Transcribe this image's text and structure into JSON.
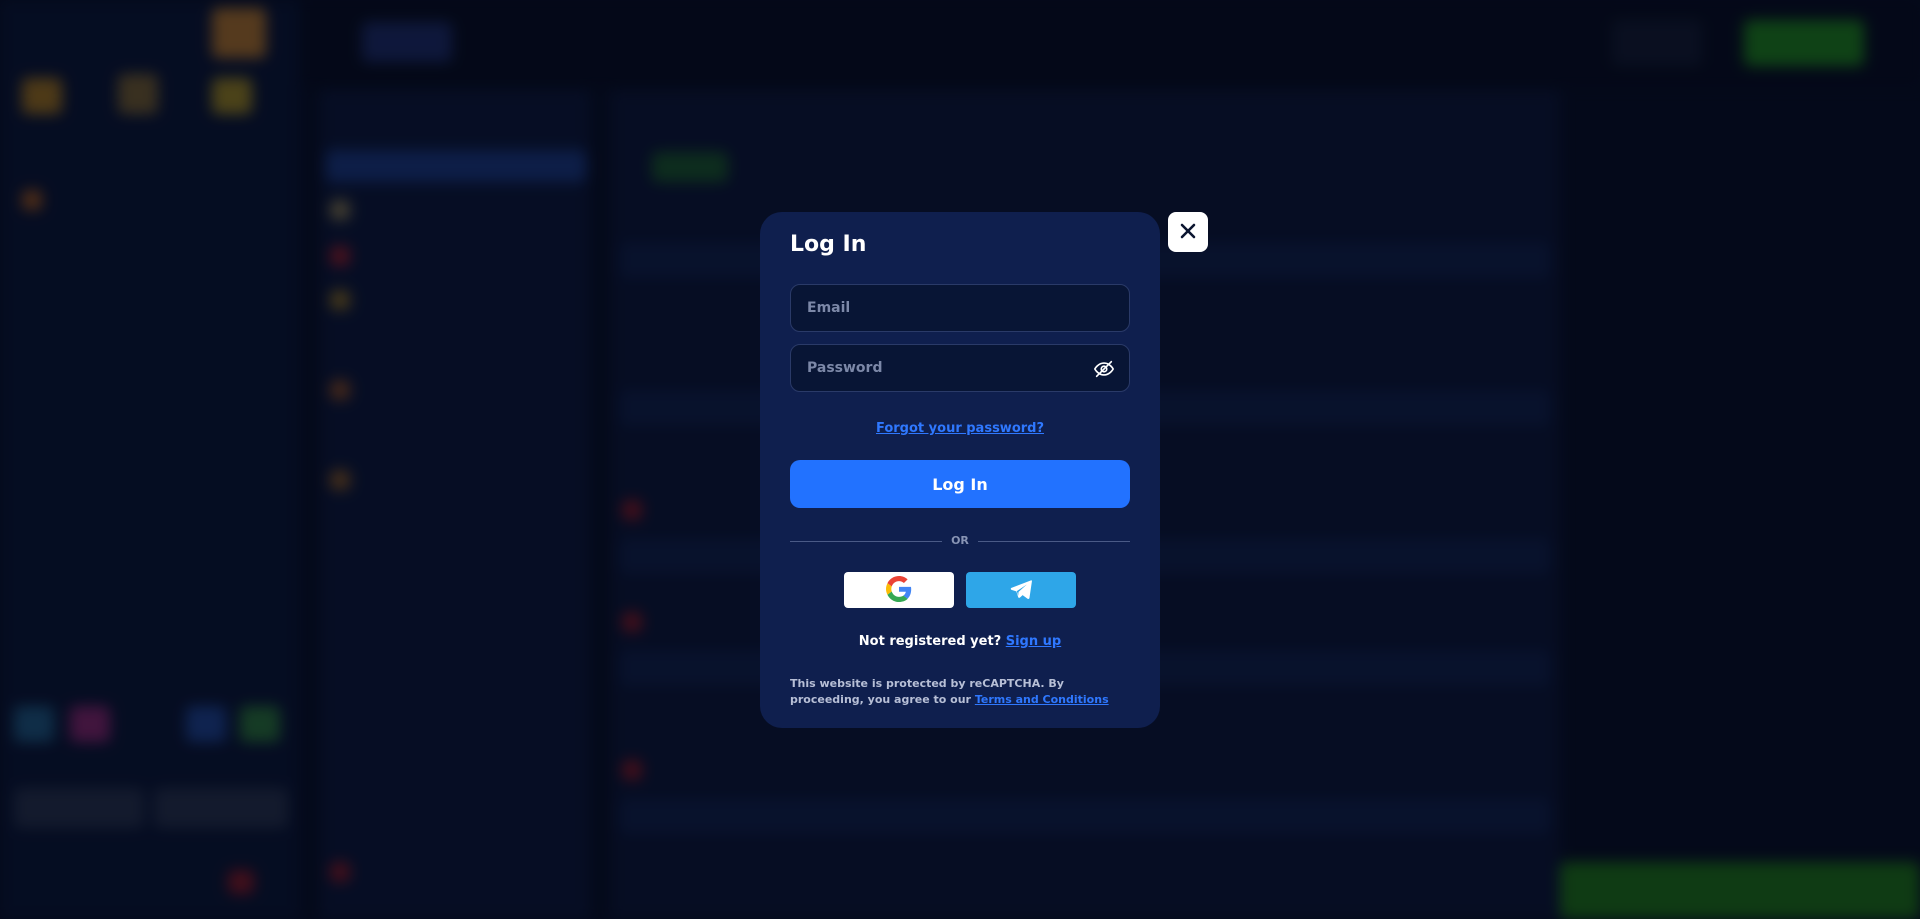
{
  "modal": {
    "title": "Log In",
    "email_placeholder": "Email",
    "password_placeholder": "Password",
    "forgot_password": "Forgot your password?",
    "login_button": "Log In",
    "divider_text": "OR",
    "register_prompt": "Not registered yet?",
    "signup_link": "Sign up",
    "legal_text": "This website is protected by reCAPTCHA. By proceeding, you agree to our",
    "terms_link": "Terms and Conditions"
  },
  "icons": {
    "close": "close-icon",
    "password_visibility": "eye-off-icon",
    "google": "google-icon",
    "telegram": "telegram-icon"
  },
  "colors": {
    "modal_bg": "#0f1f4e",
    "primary": "#2272ff",
    "link": "#2f78ff",
    "telegram": "#2ea6e8",
    "page_bg": "#060d22"
  }
}
